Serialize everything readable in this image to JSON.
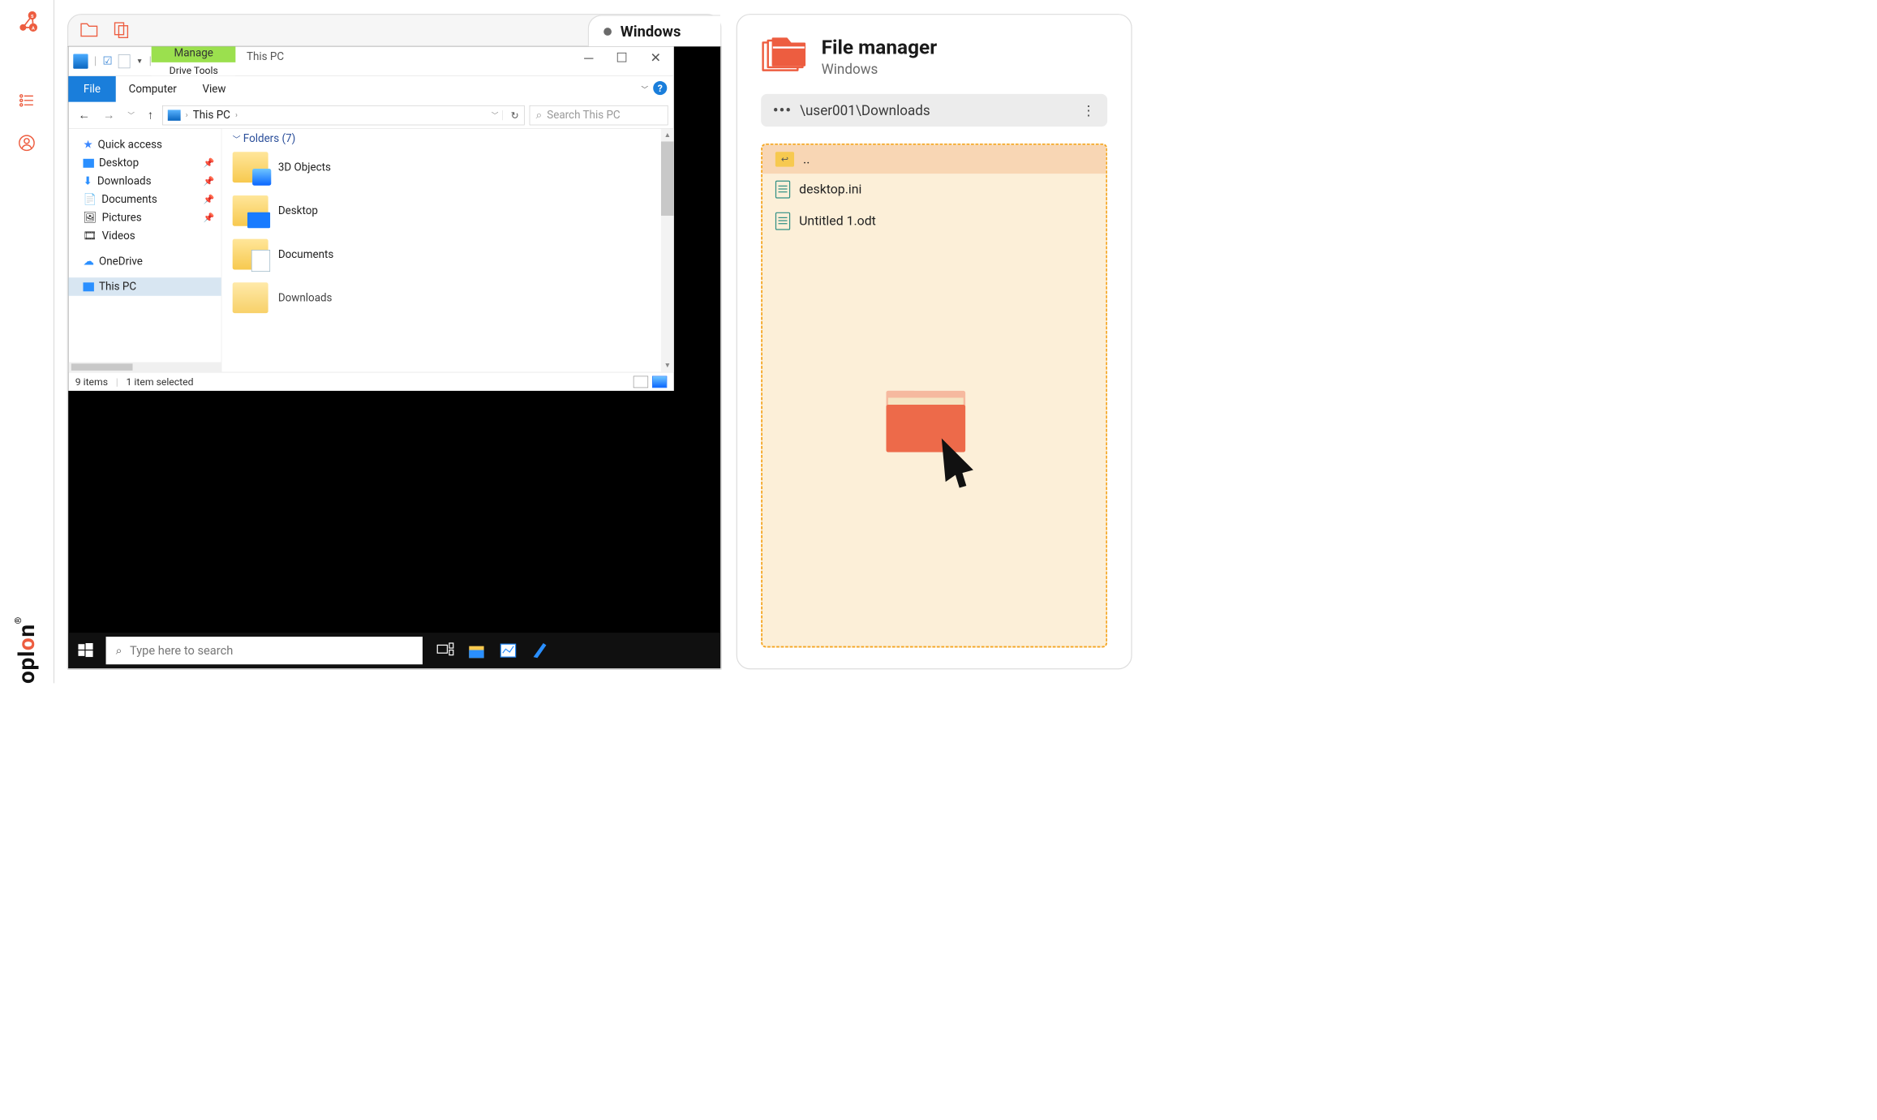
{
  "leftrail": {
    "brand": "oplon"
  },
  "tabbar": {
    "win_label": "Windows"
  },
  "explorer": {
    "manage": "Manage",
    "drive_tools": "Drive Tools",
    "location": "This PC",
    "ribbon": {
      "file": "File",
      "computer": "Computer",
      "view": "View"
    },
    "address_crumb": "This PC",
    "search_placeholder": "Search This PC",
    "side": {
      "quick": "Quick access",
      "desktop": "Desktop",
      "downloads": "Downloads",
      "documents": "Documents",
      "pictures": "Pictures",
      "videos": "Videos",
      "onedrive": "OneDrive",
      "thispc": "This PC"
    },
    "folders_group": "Folders (7)",
    "f1": "3D Objects",
    "f2": "Desktop",
    "f3": "Documents",
    "f4": "Downloads",
    "status_items": "9 items",
    "status_sel": "1 item selected"
  },
  "taskbar": {
    "search_ph": "Type here to search"
  },
  "fm": {
    "title": "File manager",
    "subtitle": "Windows",
    "path": "\\user001\\Downloads",
    "up": "..",
    "file1": "desktop.ini",
    "file2": "Untitled 1.odt"
  }
}
